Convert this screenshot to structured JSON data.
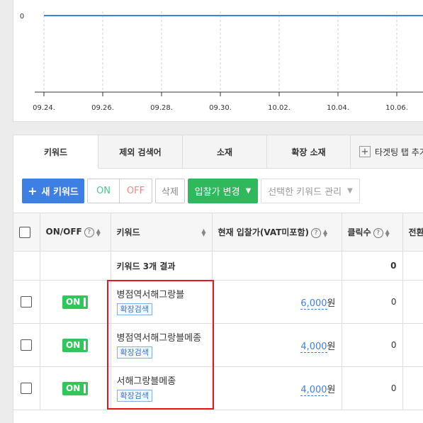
{
  "chart_data": {
    "type": "line",
    "x": [
      "09.24.",
      "09.26.",
      "09.28.",
      "09.30.",
      "10.02.",
      "10.04.",
      "10.06."
    ],
    "series": [
      {
        "values": [
          0,
          0,
          0,
          0,
          0,
          0,
          0
        ]
      }
    ],
    "y_tick_labels": [
      "0"
    ],
    "ylim": [
      0,
      1
    ],
    "grid": true,
    "line_color": "#3d7fe2"
  },
  "tabs": [
    {
      "label": "키워드",
      "active": true
    },
    {
      "label": "제외 검색어"
    },
    {
      "label": "소재"
    },
    {
      "label": "확장 소재"
    },
    {
      "label": "타겟팅 탭 추가"
    }
  ],
  "toolbar": {
    "new_keyword": "새 키워드",
    "on": "ON",
    "off": "OFF",
    "delete": "삭제",
    "bid_change": "입찰가 변경",
    "manage_selected": "선택한 키워드 관리"
  },
  "table": {
    "headers": {
      "onoff": "ON/OFF",
      "keyword": "키워드",
      "bid": "현재 입찰가(VAT미포함)",
      "clicks": "클릭수",
      "conv": "전환"
    },
    "summary": {
      "label": "키워드 3개 결과",
      "clicks": "0"
    },
    "rows": [
      {
        "status": "ON",
        "keyword": "병점역서해그랑블",
        "tag": "확장검색",
        "bid": "6,000",
        "unit": "원",
        "clicks": "0"
      },
      {
        "status": "ON",
        "keyword": "병점역서해그랑블메종",
        "tag": "확장검색",
        "bid": "4,000",
        "unit": "원",
        "clicks": "0"
      },
      {
        "status": "ON",
        "keyword": "서해그랑블메종",
        "tag": "확장검색",
        "bid": "4,000",
        "unit": "원",
        "clicks": "0"
      }
    ]
  },
  "colors": {
    "primary": "#3d7fe2",
    "green": "#2fb85c",
    "highlight": "#e8161e"
  }
}
